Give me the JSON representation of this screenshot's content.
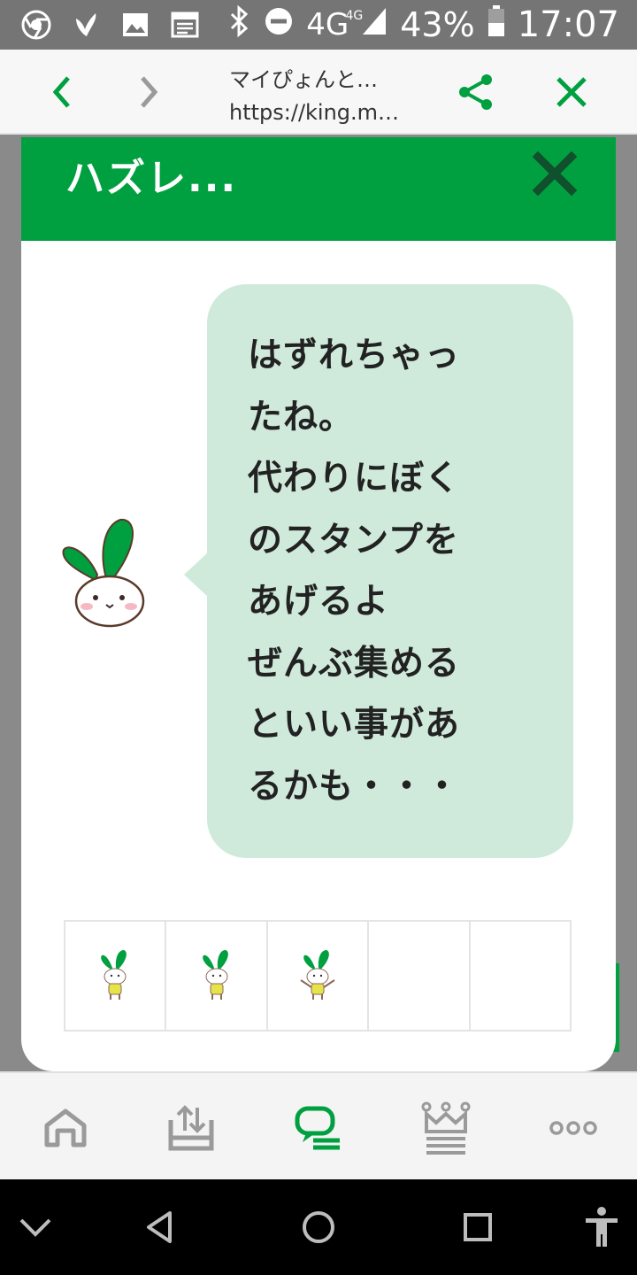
{
  "status_bar": {
    "network": "4G",
    "network_small": "4G",
    "battery": "43%",
    "time": "17:07"
  },
  "browser": {
    "page_title": "マイぴょんと…",
    "page_url": "https://king.m…"
  },
  "modal": {
    "title": "ハズレ...",
    "message_lines": [
      "はずれちゃっ",
      "たね。",
      "代わりにぼく",
      "のスタンプを",
      "あげるよ",
      "ぜんぶ集める",
      "といい事があ",
      "るかも・・・"
    ],
    "stamps": [
      {
        "filled": true
      },
      {
        "filled": true
      },
      {
        "filled": true
      },
      {
        "filled": false
      },
      {
        "filled": false
      }
    ]
  },
  "icons": {
    "status_left": [
      "chrome-icon",
      "leaf-icon",
      "image-icon",
      "calendar-icon"
    ],
    "app_nav": [
      "home-icon",
      "upload-tray-icon",
      "chat-icon",
      "crown-icon",
      "more-icon"
    ]
  },
  "colors": {
    "brand_green": "#00a040",
    "bubble_bg": "#cfeadb",
    "status_bar_bg": "#757575"
  }
}
